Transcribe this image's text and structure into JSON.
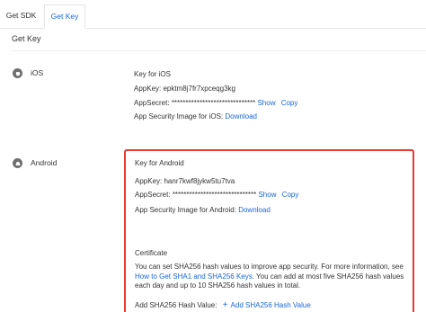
{
  "tabs": [
    {
      "label": "Get SDK"
    },
    {
      "label": "Get Key"
    }
  ],
  "title": "Get Key",
  "ios": {
    "platform": "iOS",
    "heading": "Key for iOS",
    "appkey_label": "AppKey:",
    "appkey_value": "epktm8j7fr7xpceqg3kg",
    "secret_label": "AppSecret:",
    "secret_value": "******************************",
    "show": "Show",
    "copy": "Copy",
    "image_label": "App Security Image for iOS:",
    "download": "Download"
  },
  "android": {
    "platform": "Android",
    "heading": "Key for Android",
    "appkey_label": "AppKey:",
    "appkey_value": "hanr7kwf8jykw5tu7tva",
    "secret_label": "AppSecret:",
    "secret_value": "******************************",
    "show": "Show",
    "copy": "Copy",
    "image_label": "App Security Image for Android:",
    "download": "Download",
    "certificate_title": "Certificate",
    "cert_text_before": "You can set SHA256 hash values to improve app security. For more information, see",
    "cert_link": "How to Get SHA1 and SHA256 Keys",
    "cert_text_after": ". You can add at most five SHA256 hash values each day and up to 10 SHA256 hash values in total.",
    "hash_label": "Add SHA256 Hash Value:",
    "add_hash": "Add SHA256 Hash Value"
  },
  "colors": {
    "accent": "#1a66d9",
    "highlight_border": "#e53b35",
    "icon": "#6f6f6f"
  },
  "icons": {
    "ios": "apple-icon",
    "android": "android-icon"
  }
}
